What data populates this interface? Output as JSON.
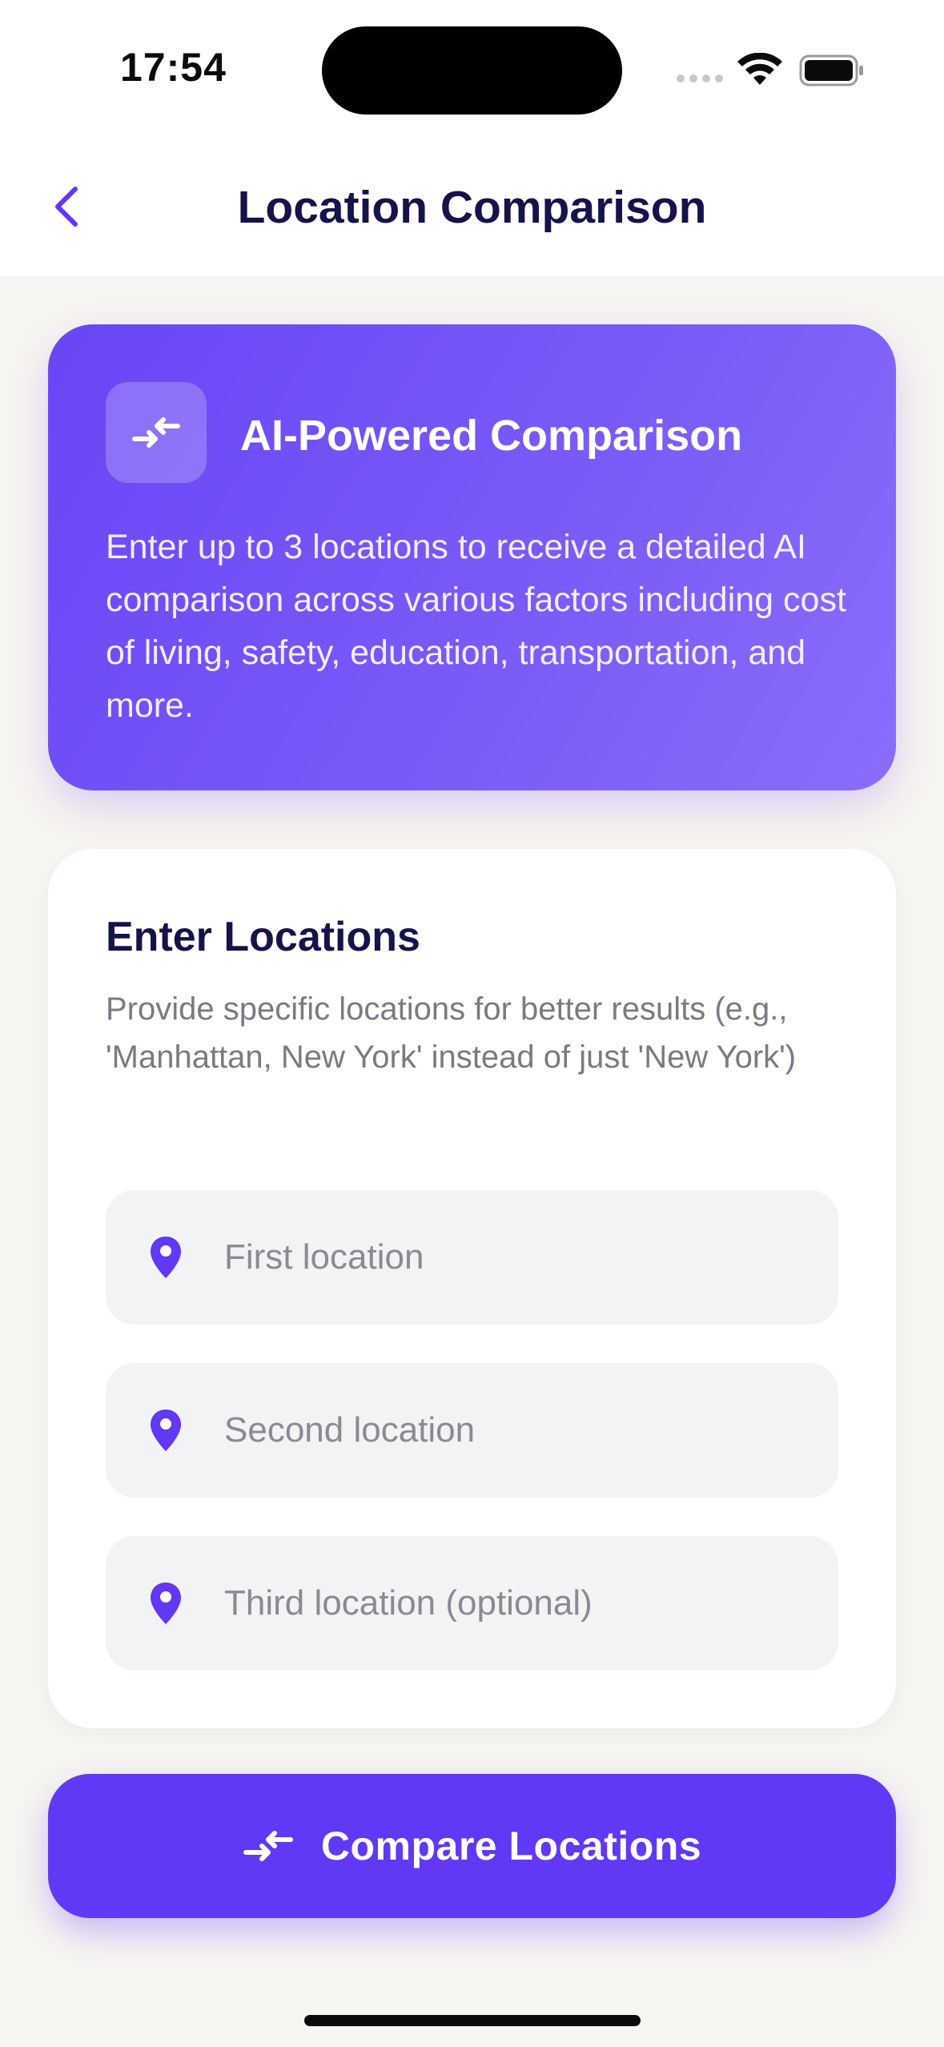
{
  "status_bar": {
    "time": "17:54"
  },
  "header": {
    "title": "Location Comparison"
  },
  "hero": {
    "title": "AI-Powered Comparison",
    "description": "Enter up to 3 locations to receive a detailed AI comparison across various factors including cost of living, safety, education, transportation, and more.",
    "icon": "compare-arrows-icon"
  },
  "form": {
    "title": "Enter Locations",
    "subtitle": "Provide specific locations for better results (e.g., 'Manhattan, New York' instead of just 'New York')",
    "fields": [
      {
        "placeholder": "First location",
        "value": "",
        "icon": "location-pin-icon"
      },
      {
        "placeholder": "Second location",
        "value": "",
        "icon": "location-pin-icon"
      },
      {
        "placeholder": "Third location (optional)",
        "value": "",
        "icon": "location-pin-icon"
      }
    ]
  },
  "cta": {
    "label": "Compare Locations",
    "icon": "compare-arrows-icon"
  },
  "colors": {
    "accent": "#6038F5",
    "hero_gradient_start": "#6A45F6",
    "hero_gradient_end": "#8A6DFA",
    "title_text": "#15134A",
    "background": "#F7F5F1",
    "field_background": "#F2F3F5"
  }
}
